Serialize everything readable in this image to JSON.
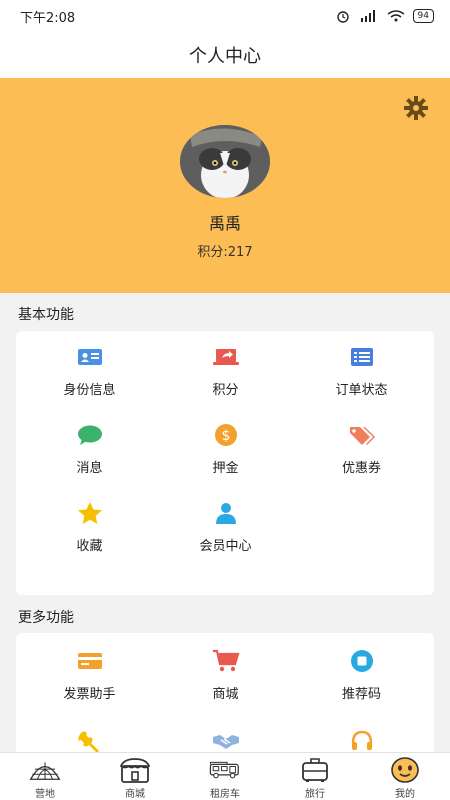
{
  "status_bar": {
    "time": "下午2:08",
    "battery": "94"
  },
  "header": {
    "title": "个人中心"
  },
  "profile": {
    "username": "禹禹",
    "points": "积分:217"
  },
  "colors": {
    "accent": "#fdbd55",
    "blue": "#4a90e2",
    "red": "#e85a4f",
    "green": "#3ab26b",
    "orange": "#f3a02c",
    "yellow": "#f5c000",
    "teal": "#29a9e1"
  },
  "basic": {
    "title": "基本功能",
    "items": [
      {
        "label": "身份信息",
        "icon": "id-card-icon"
      },
      {
        "label": "积分",
        "icon": "laptop-share-icon"
      },
      {
        "label": "订单状态",
        "icon": "list-icon"
      },
      {
        "label": "消息",
        "icon": "chat-bubble-icon"
      },
      {
        "label": "押金",
        "icon": "dollar-coin-icon"
      },
      {
        "label": "优惠券",
        "icon": "tags-icon"
      },
      {
        "label": "收藏",
        "icon": "star-icon"
      },
      {
        "label": "会员中心",
        "icon": "user-icon"
      }
    ]
  },
  "more": {
    "title": "更多功能",
    "items": [
      {
        "label": "发票助手",
        "icon": "credit-card-icon"
      },
      {
        "label": "商城",
        "icon": "shopping-cart-icon"
      },
      {
        "label": "推荐码",
        "icon": "qr-code-icon"
      },
      {
        "label": "",
        "icon": "wrench-icon"
      },
      {
        "label": "",
        "icon": "handshake-icon"
      },
      {
        "label": "",
        "icon": "headset-icon"
      }
    ]
  },
  "tabbar": {
    "items": [
      {
        "label": "营地",
        "icon": "camp-tent-icon"
      },
      {
        "label": "商城",
        "icon": "store-icon"
      },
      {
        "label": "租房车",
        "icon": "rv-icon"
      },
      {
        "label": "旅行",
        "icon": "luggage-icon"
      },
      {
        "label": "我的",
        "icon": "smiley-icon"
      }
    ]
  }
}
